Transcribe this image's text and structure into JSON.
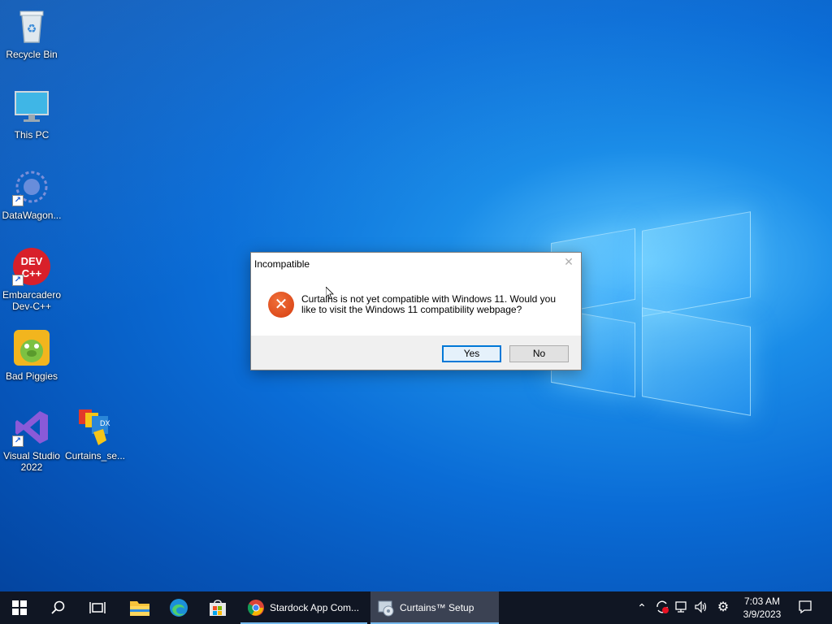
{
  "desktop": {
    "icons": [
      {
        "label": "Recycle Bin"
      },
      {
        "label": "This PC"
      },
      {
        "label": "DataWagon..."
      },
      {
        "label": "Embarcadero Dev-C++"
      },
      {
        "label": "Bad Piggies"
      },
      {
        "label": "Visual Studio 2022"
      },
      {
        "label": "Curtains_se..."
      }
    ],
    "devcpp_text": "DEV C++"
  },
  "dialog": {
    "title": "Incompatible",
    "message": "Curtains is not yet compatible with Windows 11.  Would you like to visit the Windows 11 compatibility webpage?",
    "yes_label": "Yes",
    "no_label": "No",
    "icon": "error-icon"
  },
  "taskbar": {
    "apps": [
      {
        "label": "Stardock App Com...",
        "icon": "chrome-icon"
      },
      {
        "label": "Curtains™ Setup",
        "icon": "setup-icon",
        "active": true
      }
    ],
    "clock": {
      "time": "7:03 AM",
      "date": "3/9/2023"
    }
  },
  "colors": {
    "accent": "#0078d7",
    "taskbar": "#101623",
    "error": "#d63d10"
  }
}
